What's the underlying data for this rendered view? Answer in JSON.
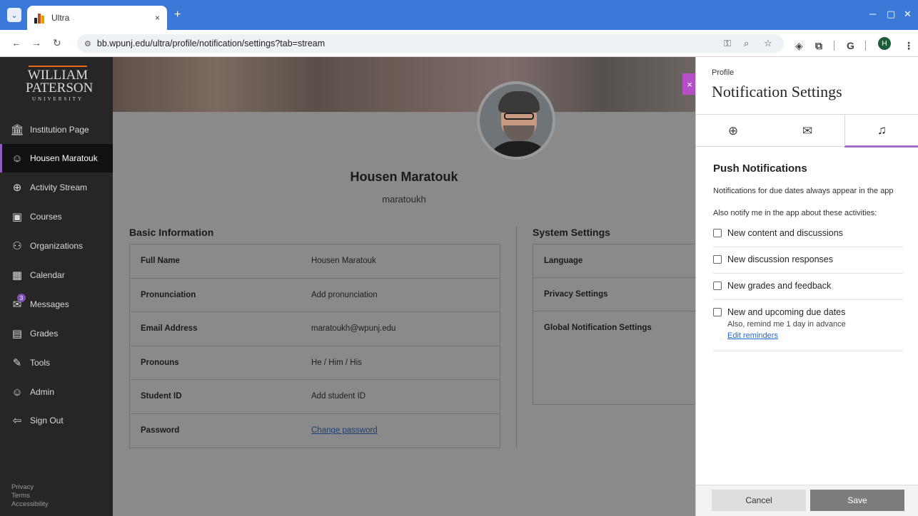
{
  "browser": {
    "tab_title": "Ultra",
    "tab_close": "×",
    "new_tab": "+",
    "url": "bb.wpunj.edu/ultra/profile/notification/settings?tab=stream",
    "profile_initial": "H",
    "ext_g": "G"
  },
  "sidebar": {
    "logo_line1": "WILLIAM",
    "logo_line2": "PATERSON",
    "logo_line3": "UNIVERSITY",
    "items": [
      {
        "label": "Institution Page"
      },
      {
        "label": "Housen Maratouk"
      },
      {
        "label": "Activity Stream"
      },
      {
        "label": "Courses"
      },
      {
        "label": "Organizations"
      },
      {
        "label": "Calendar"
      },
      {
        "label": "Messages",
        "badge": "3"
      },
      {
        "label": "Grades"
      },
      {
        "label": "Tools"
      },
      {
        "label": "Admin"
      },
      {
        "label": "Sign Out"
      }
    ],
    "footer": {
      "privacy": "Privacy",
      "terms": "Terms",
      "accessibility": "Accessibility"
    }
  },
  "profile": {
    "name": "Housen Maratouk",
    "username": "maratoukh",
    "basic_title": "Basic Information",
    "system_title": "System Settings",
    "basic_rows": [
      {
        "label": "Full Name",
        "value": "Housen Maratouk"
      },
      {
        "label": "Pronunciation",
        "value": "Add pronunciation"
      },
      {
        "label": "Email Address",
        "value": "maratoukh@wpunj.edu"
      },
      {
        "label": "Pronouns",
        "value": "He / Him / His"
      },
      {
        "label": "Student ID",
        "value": "Add student ID"
      },
      {
        "label": "Password",
        "value": "Change password"
      }
    ],
    "system_rows": [
      {
        "label": "Language"
      },
      {
        "label": "Privacy Settings"
      },
      {
        "label": "Global Notification Settings"
      }
    ]
  },
  "panel": {
    "close": "×",
    "breadcrumb": "Profile",
    "title": "Notification Settings",
    "push_title": "Push Notifications",
    "push_note": "Notifications for due dates always appear in the app",
    "also_notify": "Also notify me in the app about these activities:",
    "options": [
      {
        "label": "New content and discussions",
        "checked": false
      },
      {
        "label": "New discussion responses",
        "checked": false
      },
      {
        "label": "New grades and feedback",
        "checked": false
      },
      {
        "label": "New and upcoming due dates",
        "checked": false,
        "sub": "Also, remind me 1 day in advance",
        "link": "Edit reminders"
      }
    ],
    "cancel": "Cancel",
    "save": "Save"
  },
  "colors": {
    "browser_blue": "#3b79d8",
    "accent_purple": "#a56bc5",
    "close_magenta": "#b44fc8",
    "sidebar_bg": "#262626"
  }
}
